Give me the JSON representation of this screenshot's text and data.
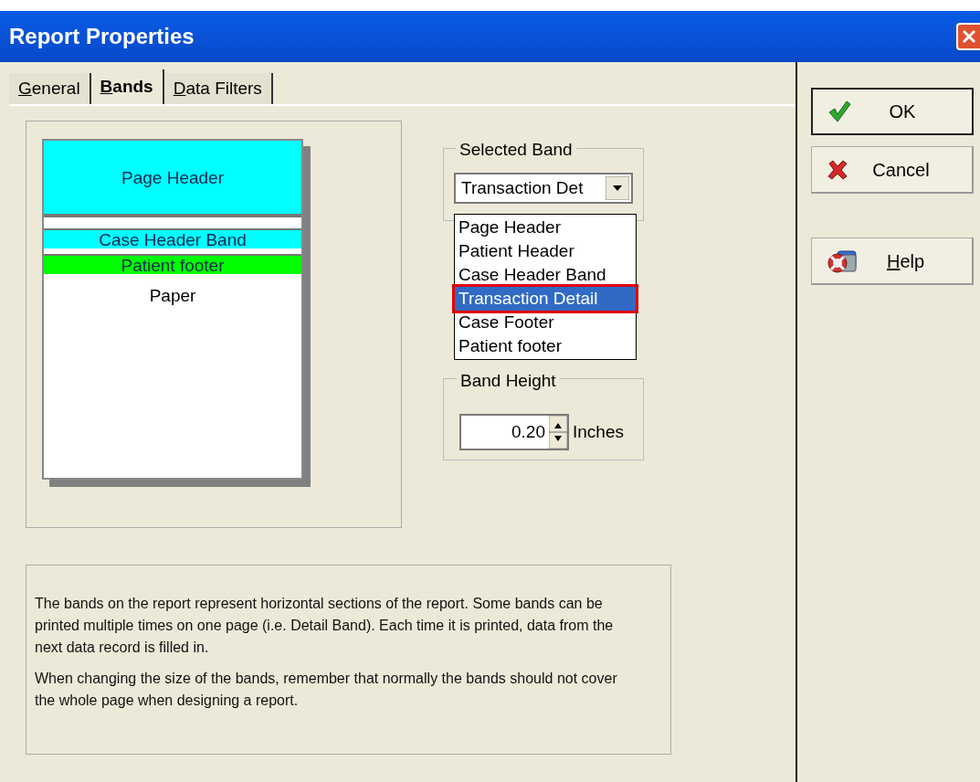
{
  "window": {
    "title": "Report Properties"
  },
  "tabs": [
    {
      "label": "General",
      "selected": false,
      "accelerator": true
    },
    {
      "label": "Bands",
      "selected": true,
      "accelerator": true
    },
    {
      "label": "Data Filters",
      "selected": false,
      "accelerator": true
    }
  ],
  "preview": {
    "bands": [
      {
        "label": "Page Header",
        "color": "#00ffff",
        "kind": "tall"
      },
      {
        "label": "Case Header Band",
        "color": "#00ffff",
        "kind": "thin"
      },
      {
        "label": "Patient footer",
        "color": "#00ff00",
        "kind": "thin"
      }
    ],
    "paper_label": "Paper"
  },
  "selected_band": {
    "legend": "Selected Band",
    "value": "Transaction Det",
    "expanded": true,
    "options": [
      {
        "label": "Page Header",
        "selected": false
      },
      {
        "label": "Patient Header",
        "selected": false
      },
      {
        "label": "Case Header Band",
        "selected": false
      },
      {
        "label": "Transaction Detail",
        "selected": true
      },
      {
        "label": "Case Footer",
        "selected": false
      },
      {
        "label": "Patient footer",
        "selected": false
      }
    ]
  },
  "band_height": {
    "legend": "Band Height",
    "value": "0.20",
    "unit": "Inches"
  },
  "description": [
    "The bands on the report represent horizontal sections of the report. Some bands can be printed multiple times on one page (i.e. Detail Band). Each time it is printed, data from the next data record is filled in.",
    "When changing the size of the bands, remember that normally the bands should not cover the whole page when designing a report."
  ],
  "buttons": [
    {
      "label": "OK",
      "kind": "ok",
      "default": true,
      "accelerator": false
    },
    {
      "label": "Cancel",
      "kind": "cancel",
      "default": false,
      "accelerator": false
    },
    {
      "label": "Help",
      "kind": "help",
      "default": false,
      "accelerator": true
    }
  ]
}
